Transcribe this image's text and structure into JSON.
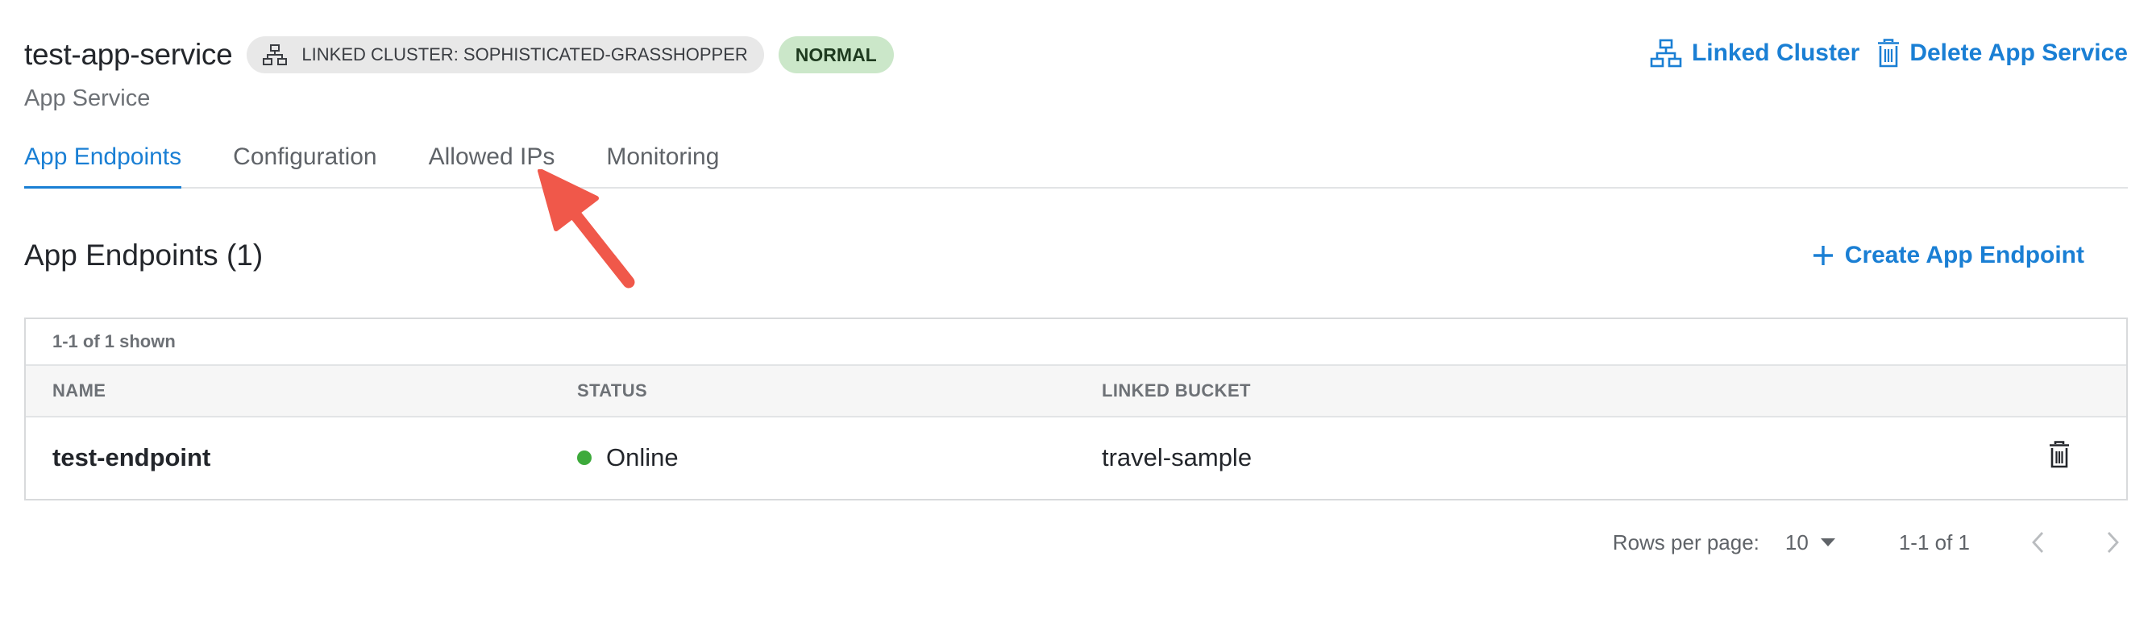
{
  "header": {
    "title": "test-app-service",
    "linked_cluster_chip": "LINKED CLUSTER: SOPHISTICATED-GRASSHOPPER",
    "status_chip": "NORMAL",
    "subtitle": "App Service",
    "actions": {
      "linked_cluster": "Linked Cluster",
      "delete_app_service": "Delete App Service"
    }
  },
  "tabs": [
    {
      "label": "App Endpoints",
      "active": true
    },
    {
      "label": "Configuration",
      "active": false
    },
    {
      "label": "Allowed IPs",
      "active": false
    },
    {
      "label": "Monitoring",
      "active": false
    }
  ],
  "section": {
    "title": "App Endpoints (1)",
    "create_button": "Create App Endpoint"
  },
  "table": {
    "meta": "1-1 of 1 shown",
    "columns": [
      "NAME",
      "STATUS",
      "LINKED BUCKET"
    ],
    "rows": [
      {
        "name": "test-endpoint",
        "status": "Online",
        "bucket": "travel-sample"
      }
    ]
  },
  "pagination": {
    "rows_per_page_label": "Rows per page:",
    "rows_per_page_value": "10",
    "range": "1-1 of 1"
  },
  "icons": {
    "cluster": "network-icon",
    "delete": "trash-icon",
    "add": "plus-icon",
    "dropdown": "caret-down-icon",
    "prev": "chevron-left-icon",
    "next": "chevron-right-icon"
  },
  "colors": {
    "accent": "#1a7fd4",
    "status_online": "#3daa3b",
    "status_chip_bg": "#cbe7c9",
    "annotation_arrow": "#f0584a"
  }
}
